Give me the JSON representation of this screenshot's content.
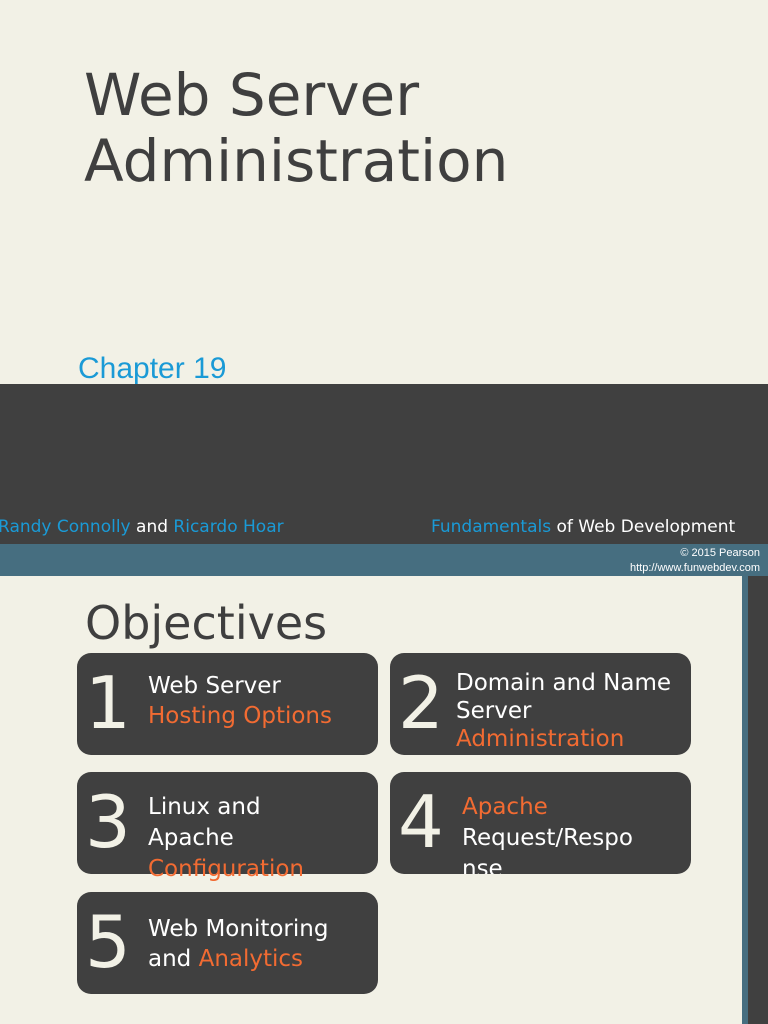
{
  "title_line1": "Web Server",
  "title_line2": "Administration",
  "chapter": "Chapter 19",
  "footer": {
    "author1": "Randy Connolly",
    "and": "and",
    "author2": "Ricardo Hoar",
    "book_highlight": "Fundamentals",
    "book_rest": "of Web Development",
    "copyright": "© 2015 Pearson",
    "url": "http://www.funwebdev.com"
  },
  "objectives_title": "Objectives",
  "objectives": [
    {
      "num": "1",
      "lines": [
        "Web Server",
        "Hosting Options"
      ]
    },
    {
      "num": "2",
      "lines": [
        "Domain and Name",
        "Server",
        "Administration"
      ]
    },
    {
      "num": "3",
      "lines": [
        "Linux and",
        "Apache",
        "Configuration"
      ]
    },
    {
      "num": "4",
      "lines": [
        "Apache",
        "Request/Respo",
        "nse"
      ]
    },
    {
      "num": "5",
      "lines": [
        "Web Monitoring",
        "and",
        "Analytics"
      ]
    }
  ],
  "colors": {
    "accent_blue": "#1a9ad6",
    "accent_orange": "#f26b32",
    "dark": "#404040",
    "band": "#466e80"
  }
}
